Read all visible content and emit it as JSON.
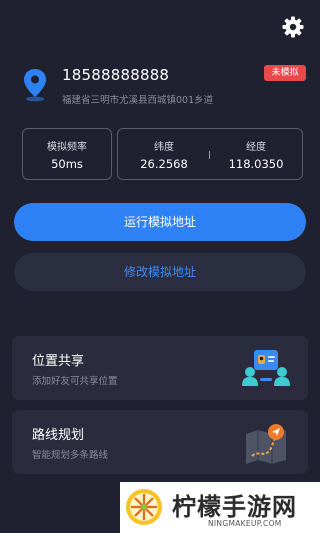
{
  "header": {
    "settings_icon": "gear-icon",
    "location_icon": "location-pin-icon",
    "phone": "18588888888",
    "address": "福建省三明市尤溪县西城镇001乡道",
    "status_badge": "未模拟",
    "status_color": "#e84a4a"
  },
  "stats": {
    "frequency_label": "模拟频率",
    "frequency_value": "50ms",
    "latitude_label": "纬度",
    "latitude_value": "26.2568",
    "longitude_label": "经度",
    "longitude_value": "118.0350"
  },
  "actions": {
    "run_label": "运行模拟地址",
    "edit_label": "修改模拟地址",
    "accent": "#2e82f6"
  },
  "features": [
    {
      "title": "位置共享",
      "subtitle": "添加好友可共享位置",
      "icon": "location-share-icon"
    },
    {
      "title": "路线规划",
      "subtitle": "智能规划多条路线",
      "icon": "route-map-icon"
    }
  ],
  "watermark": {
    "text": "柠檬手游网",
    "url": "NINGMAKEUP.COM"
  }
}
